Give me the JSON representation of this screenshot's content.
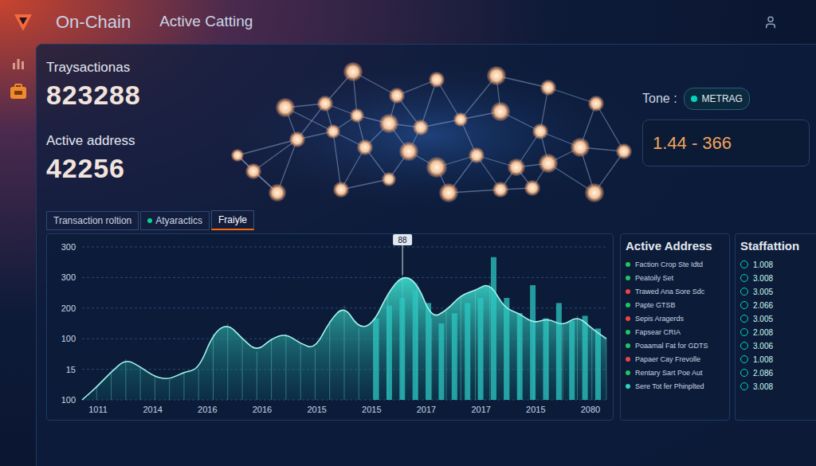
{
  "header": {
    "title": "On-Chain",
    "subtitle": "Active Catting"
  },
  "stats": [
    {
      "label": "Traysactionas",
      "value": "823288"
    },
    {
      "label": "Active address",
      "value": "42256"
    }
  ],
  "tone": {
    "label": "Tone :",
    "field": "METRAG",
    "range": "1.44 - 366"
  },
  "tabs": [
    {
      "label": "Transaction roltion",
      "selected": false,
      "dot": false
    },
    {
      "label": "Atyaractics",
      "selected": false,
      "dot": true
    },
    {
      "label": "Fraiyle",
      "selected": true,
      "dot": false
    }
  ],
  "chart": {
    "y_ticks": [
      "300",
      "300",
      "200",
      "100",
      "15",
      "100"
    ],
    "x_ticks": [
      "1011",
      "2014",
      "2016",
      "2016",
      "2015",
      "2015",
      "2017",
      "2017",
      "2015",
      "2080"
    ],
    "marker": {
      "label": "88",
      "index": 22
    },
    "series": [
      {
        "name": "area",
        "kind": "area",
        "values": [
          0,
          25,
          55,
          80,
          65,
          45,
          40,
          55,
          60,
          130,
          150,
          120,
          95,
          120,
          130,
          110,
          100,
          155,
          185,
          140,
          150,
          210,
          245,
          230,
          160,
          175,
          205,
          215,
          230,
          180,
          170,
          150,
          160,
          145,
          165,
          140,
          120
        ]
      },
      {
        "name": "bars",
        "kind": "bars",
        "values": [
          160,
          185,
          200,
          215,
          190,
          150,
          170,
          190,
          200,
          280,
          200,
          170,
          225,
          160,
          190,
          155,
          165,
          140
        ]
      }
    ]
  },
  "active_address": {
    "title": "Active Address",
    "items": [
      {
        "text": "Faction Crop Ste Idtd",
        "color": "#22c55e"
      },
      {
        "text": "Peatoily Set",
        "color": "#22c55e"
      },
      {
        "text": "Trawed Ana Sore Sdc",
        "color": "#ef4444"
      },
      {
        "text": "Papte GTSB",
        "color": "#22c55e"
      },
      {
        "text": "Sepis Aragerds",
        "color": "#ef4444"
      },
      {
        "text": "Fapsear CRIA",
        "color": "#22c55e"
      },
      {
        "text": "Poaamal Fat for GDTS",
        "color": "#22c55e"
      },
      {
        "text": "Papaer Cay Frevolle",
        "color": "#ef4444"
      },
      {
        "text": "Rentary Sart Poe Aut",
        "color": "#22c55e"
      },
      {
        "text": "Sere Tot fer Phinplted",
        "color": "#2dd4bf"
      }
    ]
  },
  "statistics": {
    "title": "Staffattion",
    "rows": [
      "1.008",
      "3.008",
      "3.005",
      "2.066",
      "3.005",
      "2.008",
      "3.006",
      "1.008",
      "2.086",
      "3.008"
    ]
  }
}
